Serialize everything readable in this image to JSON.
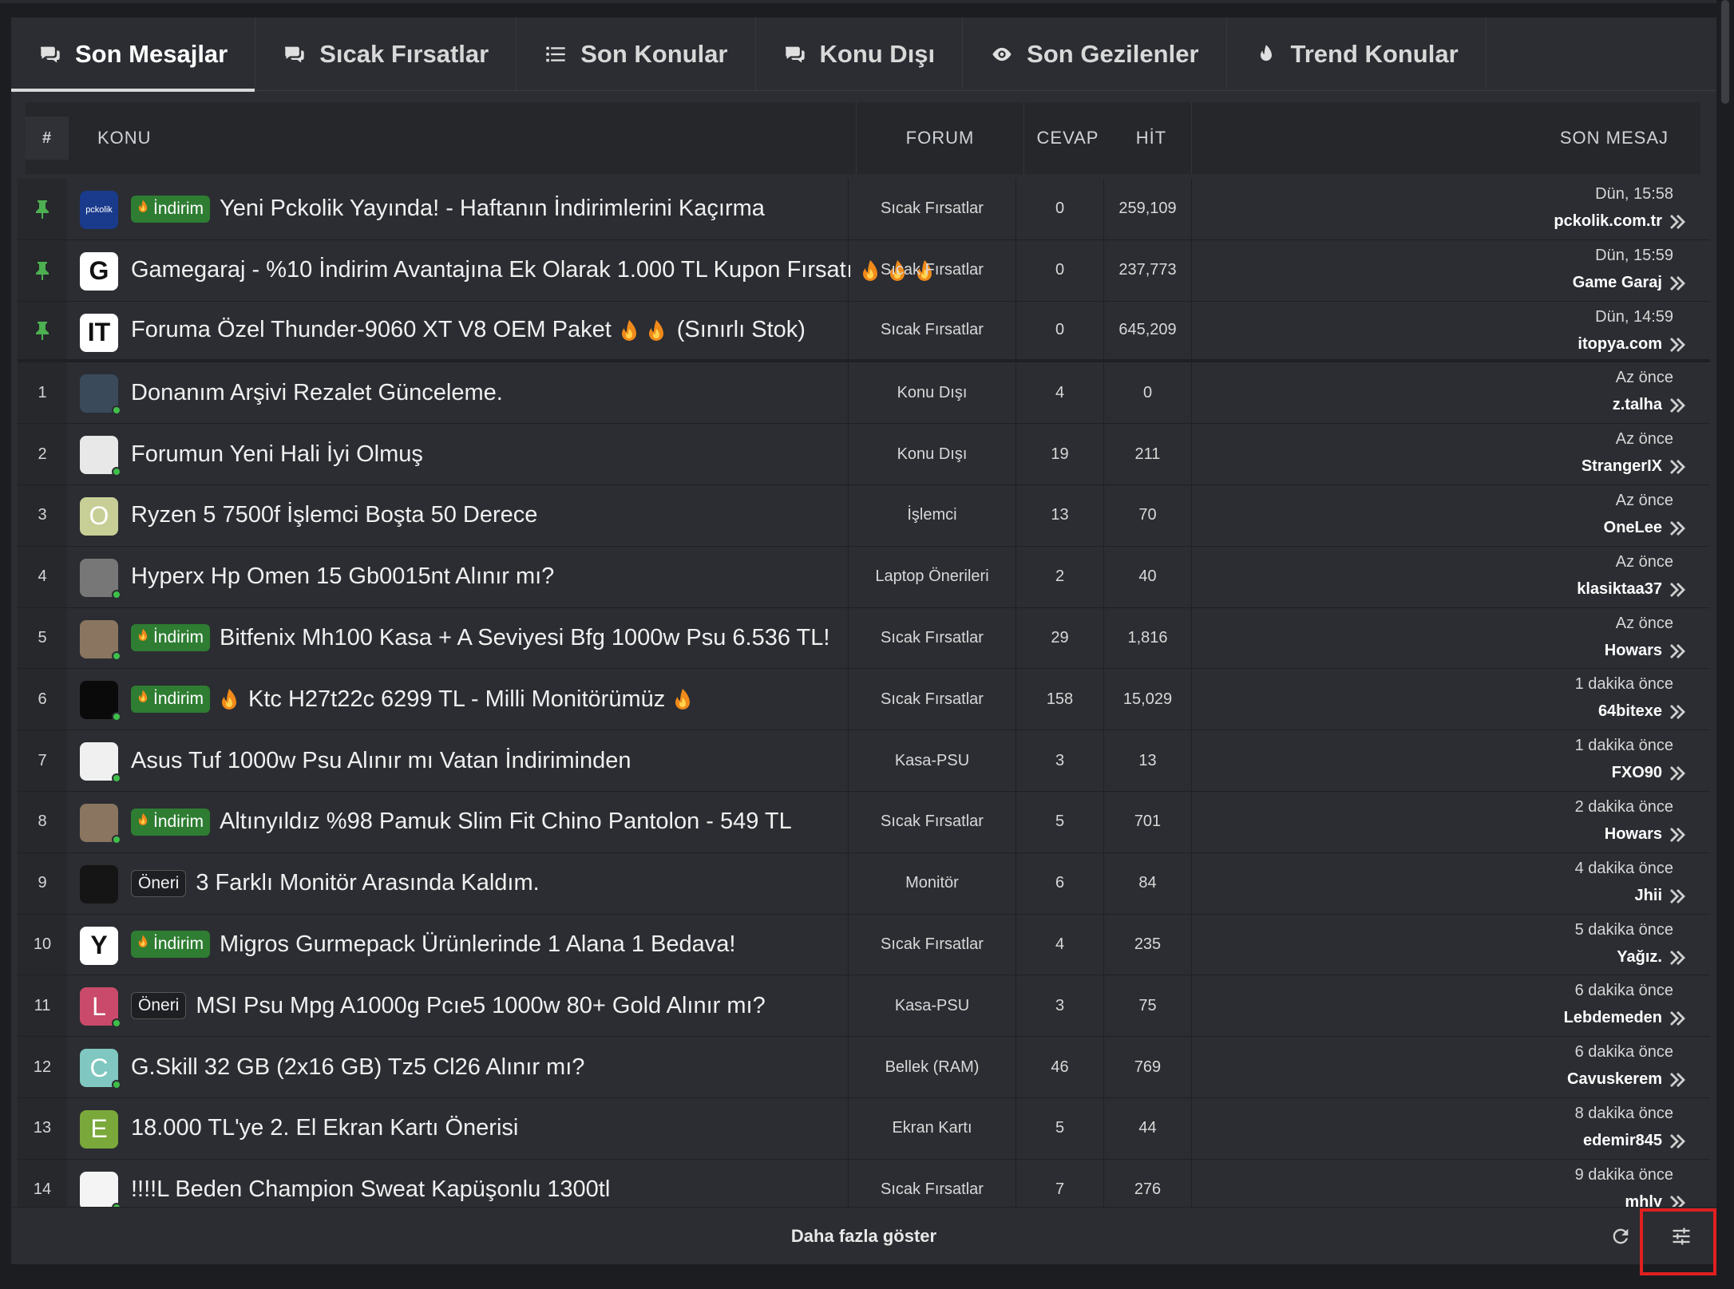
{
  "tabs": [
    {
      "label": "Son Mesajlar",
      "icon": "comments-icon",
      "active": true
    },
    {
      "label": "Sıcak Fırsatlar",
      "icon": "comments-icon",
      "active": false
    },
    {
      "label": "Son Konular",
      "icon": "list-icon",
      "active": false
    },
    {
      "label": "Konu Dışı",
      "icon": "comments-icon",
      "active": false
    },
    {
      "label": "Son Gezilenler",
      "icon": "eye-icon",
      "active": false
    },
    {
      "label": "Trend Konular",
      "icon": "fire-icon",
      "active": false
    }
  ],
  "header": {
    "num": "#",
    "konu": "KONU",
    "forum": "FORUM",
    "cevap": "CEVAP",
    "hit": "HİT",
    "son": "SON MESAJ"
  },
  "rows": [
    {
      "num": "",
      "pinned": true,
      "avatar_text": "pckolik",
      "avatar_bg": "#1a3a8c",
      "badge": "İndirim",
      "badge_type": "indirim",
      "title": "Yeni Pckolik Yayında! - Haftanın İndirimlerini Kaçırma",
      "flames_after": 0,
      "forum": "Sıcak Fırsatlar",
      "cevap": "0",
      "hit": "259,109",
      "time": "Dün, 15:58",
      "user": "pckolik.com.tr",
      "online": false
    },
    {
      "num": "",
      "pinned": true,
      "avatar_text": "G",
      "avatar_bg": "#ffffff",
      "badge": "",
      "badge_type": "",
      "title": "Gamegaraj - %10 İndirim Avantajına Ek Olarak 1.000 TL Kupon Fırsatı",
      "flames_after": 3,
      "forum": "Sıcak Fırsatlar",
      "cevap": "0",
      "hit": "237,773",
      "time": "Dün, 15:59",
      "user": "Game Garaj",
      "online": false
    },
    {
      "num": "",
      "pinned": true,
      "avatar_text": "IT",
      "avatar_bg": "#ffffff",
      "badge": "",
      "badge_type": "",
      "title": "Foruma Özel Thunder-9060 XT V8 OEM Paket",
      "flames_after": 2,
      "title_suffix": "(Sınırlı Stok)",
      "forum": "Sıcak Fırsatlar",
      "cevap": "0",
      "hit": "645,209",
      "time": "Dün, 14:59",
      "user": "itopya.com",
      "online": false
    },
    {
      "num": "1",
      "pinned": false,
      "avatar_text": "",
      "avatar_bg": "#3a4a5a",
      "badge": "",
      "badge_type": "",
      "title": "Donanım Arşivi Rezalet Günceleme.",
      "flames_after": 0,
      "forum": "Konu Dışı",
      "cevap": "4",
      "hit": "0",
      "time": "Az önce",
      "user": "z.talha",
      "online": true
    },
    {
      "num": "2",
      "pinned": false,
      "avatar_text": "",
      "avatar_bg": "#e8e8e8",
      "badge": "",
      "badge_type": "",
      "title": "Forumun Yeni Hali İyi Olmuş",
      "flames_after": 0,
      "forum": "Konu Dışı",
      "cevap": "19",
      "hit": "211",
      "time": "Az önce",
      "user": "StrangerIX",
      "online": true
    },
    {
      "num": "3",
      "pinned": false,
      "avatar_text": "O",
      "avatar_bg": "#c8cf96",
      "badge": "",
      "badge_type": "",
      "title": "Ryzen 5 7500f İşlemci Boşta 50 Derece",
      "flames_after": 0,
      "forum": "İşlemci",
      "cevap": "13",
      "hit": "70",
      "time": "Az önce",
      "user": "OneLee",
      "online": false
    },
    {
      "num": "4",
      "pinned": false,
      "avatar_text": "",
      "avatar_bg": "#777777",
      "badge": "",
      "badge_type": "",
      "title": "Hyperx Hp Omen 15 Gb0015nt Alınır mı?",
      "flames_after": 0,
      "forum": "Laptop Önerileri",
      "cevap": "2",
      "hit": "40",
      "time": "Az önce",
      "user": "klasiktaa37",
      "online": true
    },
    {
      "num": "5",
      "pinned": false,
      "avatar_text": "",
      "avatar_bg": "#8a7560",
      "badge": "İndirim",
      "badge_type": "indirim",
      "title": "Bitfenix Mh100 Kasa + A Seviyesi Bfg 1000w Psu 6.536 TL!",
      "flames_after": 0,
      "forum": "Sıcak Fırsatlar",
      "cevap": "29",
      "hit": "1,816",
      "time": "Az önce",
      "user": "Howars",
      "online": true
    },
    {
      "num": "6",
      "pinned": false,
      "avatar_text": "",
      "avatar_bg": "#0a0a0a",
      "badge": "İndirim",
      "badge_type": "indirim",
      "flame_before": true,
      "title": "Ktc H27t22c 6299 TL - Milli Monitörümüz",
      "flames_after": 1,
      "forum": "Sıcak Fırsatlar",
      "cevap": "158",
      "hit": "15,029",
      "time": "1 dakika önce",
      "user": "64bitexe",
      "online": true
    },
    {
      "num": "7",
      "pinned": false,
      "avatar_text": "",
      "avatar_bg": "#f0f0f0",
      "badge": "",
      "badge_type": "",
      "title": "Asus Tuf 1000w Psu Alınır mı Vatan İndiriminden",
      "flames_after": 0,
      "forum": "Kasa-PSU",
      "cevap": "3",
      "hit": "13",
      "time": "1 dakika önce",
      "user": "FXO90",
      "online": true
    },
    {
      "num": "8",
      "pinned": false,
      "avatar_text": "",
      "avatar_bg": "#8a7560",
      "badge": "İndirim",
      "badge_type": "indirim",
      "title": "Altınyıldız %98 Pamuk Slim Fit Chino Pantolon - 549 TL",
      "flames_after": 0,
      "forum": "Sıcak Fırsatlar",
      "cevap": "5",
      "hit": "701",
      "time": "2 dakika önce",
      "user": "Howars",
      "online": true
    },
    {
      "num": "9",
      "pinned": false,
      "avatar_text": "",
      "avatar_bg": "#151515",
      "badge": "Öneri",
      "badge_type": "oneri",
      "title": "3 Farklı Monitör Arasında Kaldım.",
      "flames_after": 0,
      "forum": "Monitör",
      "cevap": "6",
      "hit": "84",
      "time": "4 dakika önce",
      "user": "Jhii",
      "online": false
    },
    {
      "num": "10",
      "pinned": false,
      "avatar_text": "Y",
      "avatar_bg": "#ffffff",
      "badge": "İndirim",
      "badge_type": "indirim",
      "title": "Migros Gurmepack Ürünlerinde 1 Alana 1 Bedava!",
      "flames_after": 0,
      "forum": "Sıcak Fırsatlar",
      "cevap": "4",
      "hit": "235",
      "time": "5 dakika önce",
      "user": "Yağız.",
      "online": false
    },
    {
      "num": "11",
      "pinned": false,
      "avatar_text": "L",
      "avatar_bg": "#c94a6a",
      "badge": "Öneri",
      "badge_type": "oneri",
      "title": "MSI Psu Mpg A1000g Pcıe5 1000w 80+ Gold Alınır mı?",
      "flames_after": 0,
      "forum": "Kasa-PSU",
      "cevap": "3",
      "hit": "75",
      "time": "6 dakika önce",
      "user": "Lebdemeden",
      "online": true
    },
    {
      "num": "12",
      "pinned": false,
      "avatar_text": "C",
      "avatar_bg": "#7fc7c0",
      "badge": "",
      "badge_type": "",
      "title": "G.Skill 32 GB (2x16 GB) Tz5 Cl26 Alınır mı?",
      "flames_after": 0,
      "forum": "Bellek (RAM)",
      "cevap": "46",
      "hit": "769",
      "time": "6 dakika önce",
      "user": "Cavuskerem",
      "online": true
    },
    {
      "num": "13",
      "pinned": false,
      "avatar_text": "E",
      "avatar_bg": "#7aa83a",
      "badge": "",
      "badge_type": "",
      "title": "18.000 TL'ye 2. El Ekran Kartı Önerisi",
      "flames_after": 0,
      "forum": "Ekran Kartı",
      "cevap": "5",
      "hit": "44",
      "time": "8 dakika önce",
      "user": "edemir845",
      "online": false
    },
    {
      "num": "14",
      "pinned": false,
      "avatar_text": "",
      "avatar_bg": "#f4f4f4",
      "badge": "",
      "badge_type": "",
      "title": "!!!!L Beden Champion Sweat Kapüşonlu 1300tl",
      "flames_after": 0,
      "forum": "Sıcak Fırsatlar",
      "cevap": "7",
      "hit": "276",
      "time": "9 dakika önce",
      "user": "mhly",
      "online": true
    }
  ],
  "footer": {
    "more_label": "Daha fazla göster",
    "refresh_icon": "refresh-icon",
    "settings_icon": "sliders-icon"
  },
  "colors": {
    "badge_indirim": "#2e7d32",
    "highlight": "#e02020",
    "online": "#3fbf4a"
  }
}
